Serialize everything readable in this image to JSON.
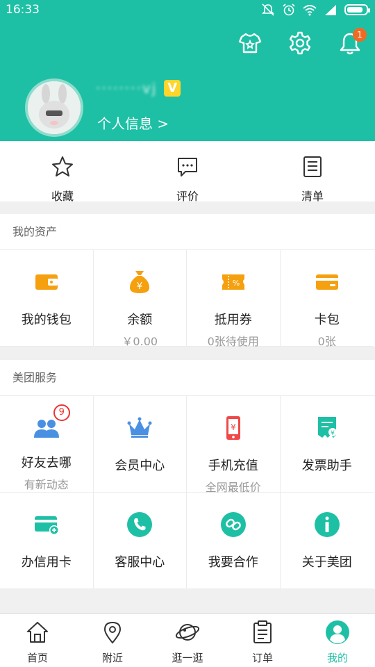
{
  "status_bar": {
    "time": "16:33",
    "battery_level": 0.85
  },
  "colors": {
    "brand": "#1ec0a5",
    "orange": "#f5a00f",
    "blue": "#4a90e2",
    "red": "#f04848",
    "badge": "#f06a23"
  },
  "header": {
    "notification_count": "1",
    "username": "········vj",
    "vip_badge": "V",
    "profile_link": "个人信息 >"
  },
  "quick_actions": [
    {
      "label": "收藏",
      "icon": "star-icon"
    },
    {
      "label": "评价",
      "icon": "comment-icon"
    },
    {
      "label": "清单",
      "icon": "list-icon"
    }
  ],
  "assets": {
    "title": "我的资产",
    "items": [
      {
        "label": "我的钱包",
        "sub": "",
        "icon": "wallet-icon"
      },
      {
        "label": "余额",
        "sub": "￥0.00",
        "icon": "money-bag-icon"
      },
      {
        "label": "抵用券",
        "sub": "0张待使用",
        "icon": "coupon-icon"
      },
      {
        "label": "卡包",
        "sub": "0张",
        "icon": "card-icon"
      }
    ]
  },
  "services": {
    "title": "美团服务",
    "items": [
      {
        "label": "好友去哪",
        "sub": "有新动态",
        "icon": "friends-icon",
        "badge": "9"
      },
      {
        "label": "会员中心",
        "sub": "",
        "icon": "crown-icon"
      },
      {
        "label": "手机充值",
        "sub": "全网最低价",
        "icon": "phone-recharge-icon"
      },
      {
        "label": "发票助手",
        "sub": "",
        "icon": "invoice-icon"
      },
      {
        "label": "办信用卡",
        "sub": "",
        "icon": "credit-card-icon"
      },
      {
        "label": "客服中心",
        "sub": "",
        "icon": "customer-service-icon"
      },
      {
        "label": "我要合作",
        "sub": "",
        "icon": "cooperation-icon"
      },
      {
        "label": "关于美团",
        "sub": "",
        "icon": "info-icon"
      }
    ]
  },
  "bottom_nav": [
    {
      "label": "首页",
      "icon": "home-icon"
    },
    {
      "label": "附近",
      "icon": "location-icon"
    },
    {
      "label": "逛一逛",
      "icon": "planet-icon"
    },
    {
      "label": "订单",
      "icon": "order-icon"
    },
    {
      "label": "我的",
      "icon": "profile-icon",
      "active": true
    }
  ]
}
